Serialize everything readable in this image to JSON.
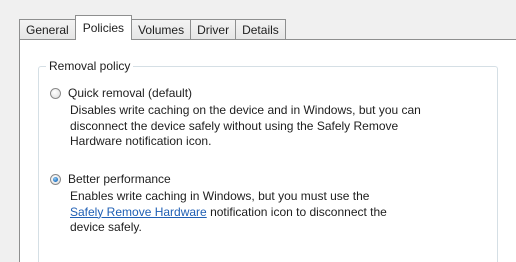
{
  "tabs": [
    {
      "label": "General",
      "active": false
    },
    {
      "label": "Policies",
      "active": true
    },
    {
      "label": "Volumes",
      "active": false
    },
    {
      "label": "Driver",
      "active": false
    },
    {
      "label": "Details",
      "active": false
    }
  ],
  "removal_policy": {
    "group_title": "Removal policy",
    "options": [
      {
        "label": "Quick removal (default)",
        "selected": false,
        "description_lines": [
          "Disables write caching on the device and in Windows, but you can",
          "disconnect the device safely without using the Safely Remove",
          "Hardware notification icon."
        ]
      },
      {
        "label": "Better performance",
        "selected": true,
        "description_line1": "Enables write caching in Windows, but you must use the",
        "description_link": "Safely Remove Hardware",
        "description_line2_rest": " notification icon to disconnect the",
        "description_line3": "device safely."
      }
    ]
  },
  "colors": {
    "link": "#1f5fb4",
    "radio_selected": "#2a7bc8",
    "group_border": "#d5dfe5"
  }
}
